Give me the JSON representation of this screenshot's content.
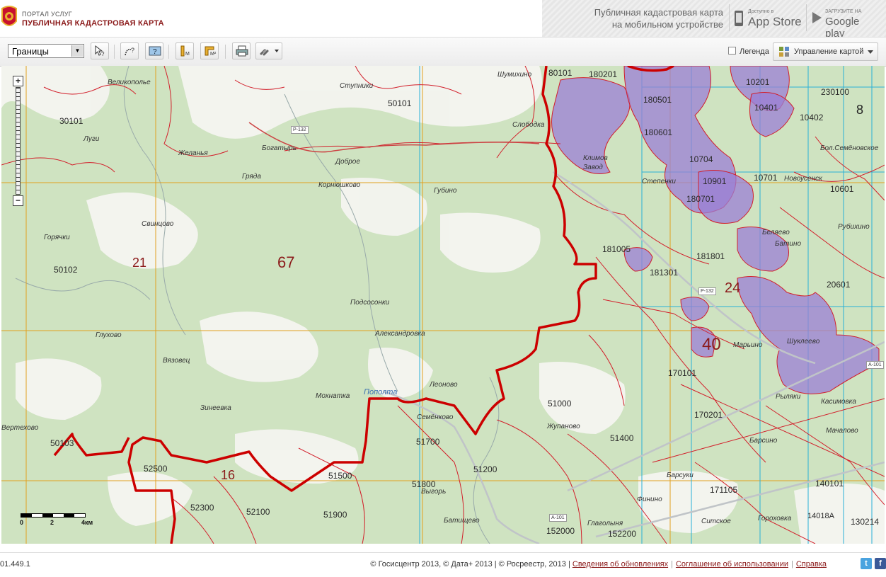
{
  "header": {
    "portal_small": "ПОРТАЛ УСЛУГ",
    "portal_title": "ПУБЛИЧНАЯ КАДАСТРОВАЯ КАРТА",
    "mobile_line1": "Публичная кадастровая карта",
    "mobile_line2": "на мобильном устройстве",
    "appstore_small": "Доступно в",
    "appstore_big": "App Store",
    "gplay_small": "ЗАГРУЗИТЕ НА",
    "gplay_big": "Google play"
  },
  "toolbar": {
    "layer_select_value": "Границы",
    "legend_label": "Легенда",
    "map_management_label": "Управление картой"
  },
  "map": {
    "scale": {
      "t0": "0",
      "t2": "2",
      "t4": "4км"
    },
    "cadastral_labels": [
      "80101",
      "180201",
      "50101",
      "30101",
      "10201",
      "230100",
      "10401",
      "10402",
      "180501",
      "180601",
      "10704",
      "10901",
      "10701",
      "180701",
      "10601",
      "181005",
      "181801",
      "181301",
      "20601",
      "50102",
      "170101",
      "170201",
      "51000",
      "51400",
      "51700",
      "51200",
      "51800",
      "50103",
      "52500",
      "51500",
      "52300",
      "52100",
      "51900",
      "152000",
      "152200",
      "171105",
      "140101",
      "14018А",
      "130214"
    ],
    "district_numbers": [
      "67",
      "21",
      "24",
      "40",
      "16",
      "8"
    ],
    "places": [
      "Великополье",
      "Ступники",
      "Шумихино",
      "Луги",
      "Желанья",
      "Богатырь",
      "Слободка",
      "Гряда",
      "Доброе",
      "Корнюшково",
      "Губино",
      "Климов Завод",
      "Степенки",
      "Новоусенск",
      "Бол.Семёновское",
      "Свинцово",
      "Горячки",
      "Беляево",
      "Батино",
      "Рубихино",
      "Подсосонки",
      "Александровка",
      "Глухово",
      "Вязовец",
      "Марьино",
      "Шуклеево",
      "Мохнатка",
      "Пополта",
      "Леоново",
      "Семёнково",
      "Зинеевка",
      "Вертехово",
      "Жупаново",
      "Рыляки",
      "Касимовка",
      "Барсуки",
      "Барсино",
      "Мачалово",
      "Выгорь",
      "Батищево",
      "Глаголыня",
      "Финино",
      "Ситское",
      "Гороховка"
    ],
    "road_labels": [
      "Р-132",
      "Р-132",
      "А-101",
      "А-101"
    ]
  },
  "footer": {
    "version": "01.449.1",
    "copyright": "© Госисцентр 2013, © Дата+ 2013 | © Росреестр, 2013 |",
    "link_updates": "Сведения об обновлениях",
    "link_terms": "Соглашение об использовании",
    "link_help": "Справка",
    "twitter_glyph": "t",
    "facebook_glyph": "f"
  },
  "colors": {
    "district_border": "#cc0000",
    "parcel_line": "#d21e2a",
    "parcel_fill": "#9b7fd4",
    "grid_orange": "#e0a020",
    "grid_cyan": "#2ab0d8",
    "forest": "#cfe3c1",
    "brand": "#8b1a1a"
  }
}
